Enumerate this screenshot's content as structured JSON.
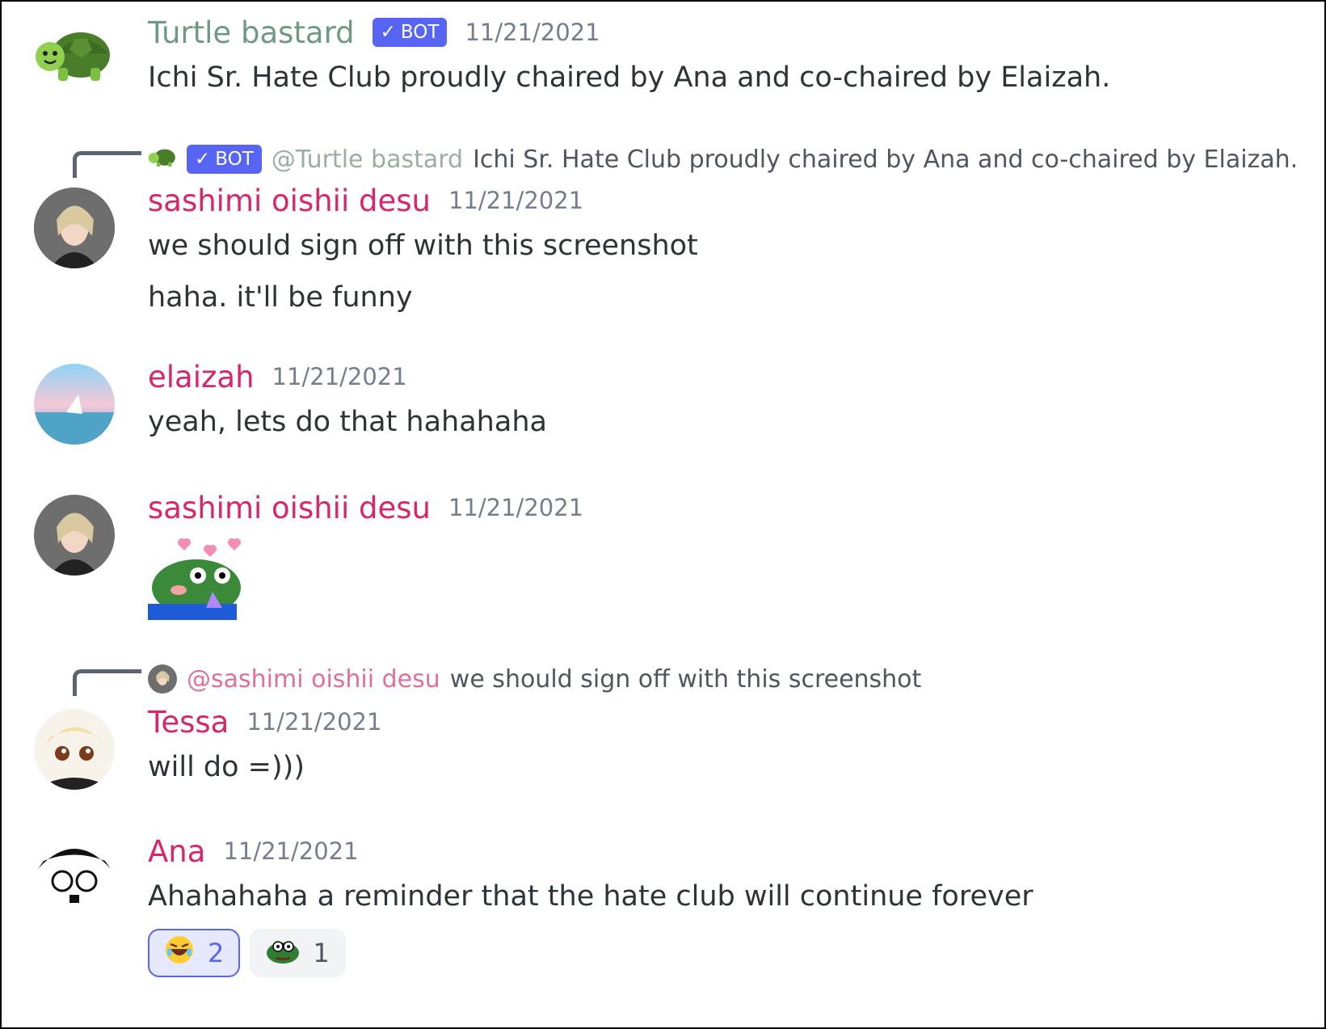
{
  "messages": {
    "m1": {
      "username": "Turtle bastard",
      "bot_badge": "BOT",
      "timestamp": "11/21/2021",
      "text": "Ichi Sr. Hate Club proudly chaired by Ana and co-chaired by Elaizah."
    },
    "m2": {
      "reply": {
        "bot_badge": "BOT",
        "mention": "@Turtle bastard",
        "text": "Ichi Sr. Hate Club proudly chaired by Ana and co-chaired by Elaizah."
      },
      "username": "sashimi oishii desu",
      "timestamp": "11/21/2021",
      "lines": [
        "we should sign off with this screenshot",
        "haha. it'll be funny"
      ]
    },
    "m3": {
      "username": "elaizah",
      "timestamp": "11/21/2021",
      "text": "yeah, lets do that hahahaha"
    },
    "m4": {
      "username": "sashimi oishii desu",
      "timestamp": "11/21/2021",
      "sticker": "pepe-hearts-sticker"
    },
    "m5": {
      "reply": {
        "mention": "@sashimi oishii desu",
        "text": "we should sign off with this screenshot"
      },
      "username": "Tessa",
      "timestamp": "11/21/2021",
      "text": "will do =)))"
    },
    "m6": {
      "username": "Ana",
      "timestamp": "11/21/2021",
      "text": "Ahahahaha a reminder that the hate club will continue forever",
      "reactions": [
        {
          "emoji": "rolling-on-floor-laughing-emoji",
          "count": "2",
          "reacted_by_me": true
        },
        {
          "emoji": "pepe-emoji",
          "count": "1",
          "reacted_by_me": false
        }
      ]
    }
  },
  "colors": {
    "username": "#d8256b",
    "bot_username": "#6f9a82",
    "bot_badge": "#5865f2",
    "timestamp": "#747f8d",
    "text": "#2e3338"
  }
}
